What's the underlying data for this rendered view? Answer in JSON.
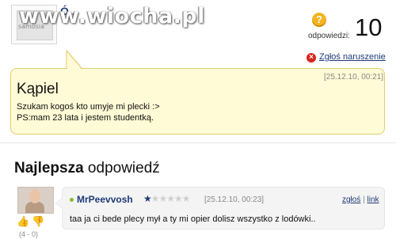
{
  "watermark": "www.wiocha.pl",
  "header": {
    "user_partial": "Ó...",
    "avatar_caption": "samosia",
    "answers_label": "odpowiedzi:",
    "answers_count": "10",
    "report_label": "Zgłoś naruszenie",
    "question_icon": "question-mark-icon"
  },
  "question": {
    "date": "[25.12.10, 00:21]",
    "title": "Kąpiel",
    "lines": [
      "Szukam kogoś kto umyje mi plecki :>",
      "PS:mam 23 lata i jestem studentką."
    ]
  },
  "best_answer": {
    "title_bold": "Najlepsza",
    "title_rest": " odpowiedź",
    "user": "MrPeevvosh",
    "rank_stars_filled": 1,
    "rank_stars_total": 6,
    "date": "[25.12.10, 00:23]",
    "report_link": "zgłoś",
    "separator": "|",
    "link_link": "link",
    "text": "taa ja ci bede plecy mył a ty mi opier dolisz wszystko z lodówki..",
    "votes": "(4 - 0)"
  },
  "colors": {
    "link": "#1e3a78",
    "question_bg": "#fffbd6",
    "question_border": "#e3cc6c",
    "answer_bg": "#f4f4f4",
    "report_red": "#d7261e",
    "question_icon": "#f4b321"
  }
}
